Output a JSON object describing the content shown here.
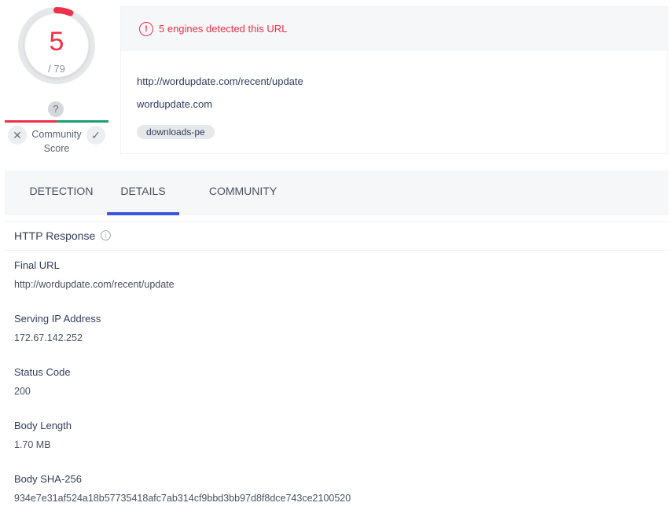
{
  "score": {
    "detected": "5",
    "total": "/ 79",
    "detected_ratio": 0.063,
    "detected_color": "#f0304b",
    "ring_color": "#e6e7ea"
  },
  "community": {
    "label_line1": "Community",
    "label_line2": "Score",
    "question_icon": "question-icon",
    "negative_icon": "close-icon",
    "positive_icon": "check-icon",
    "negative_color": "#f0304b",
    "positive_color": "#1aa06d"
  },
  "header": {
    "alert_text": "5 engines detected this URL",
    "alert_icon": "alert-circle-icon",
    "url": "http://wordupdate.com/recent/update",
    "domain": "wordupdate.com",
    "tag": "downloads-pe"
  },
  "tabs": [
    {
      "label": "DETECTION",
      "active": false
    },
    {
      "label": "DETAILS",
      "active": true
    },
    {
      "label": "COMMUNITY",
      "active": false
    }
  ],
  "details": {
    "section_title": "HTTP Response",
    "info_icon": "info-icon",
    "fields": [
      {
        "label": "Final URL",
        "value": "http://wordupdate.com/recent/update"
      },
      {
        "label": "Serving IP Address",
        "value": "172.67.142.252"
      },
      {
        "label": "Status Code",
        "value": "200"
      },
      {
        "label": "Body Length",
        "value": "1.70 MB"
      },
      {
        "label": "Body SHA-256",
        "value": "934e7e31af524a18b57735418afc7ab314cf9bbd3bb97d8f8dce743ce2100520"
      }
    ]
  },
  "colors": {
    "accent_blue": "#3b56e0",
    "danger_red": "#f0304b",
    "text_dark": "#313d5a"
  }
}
